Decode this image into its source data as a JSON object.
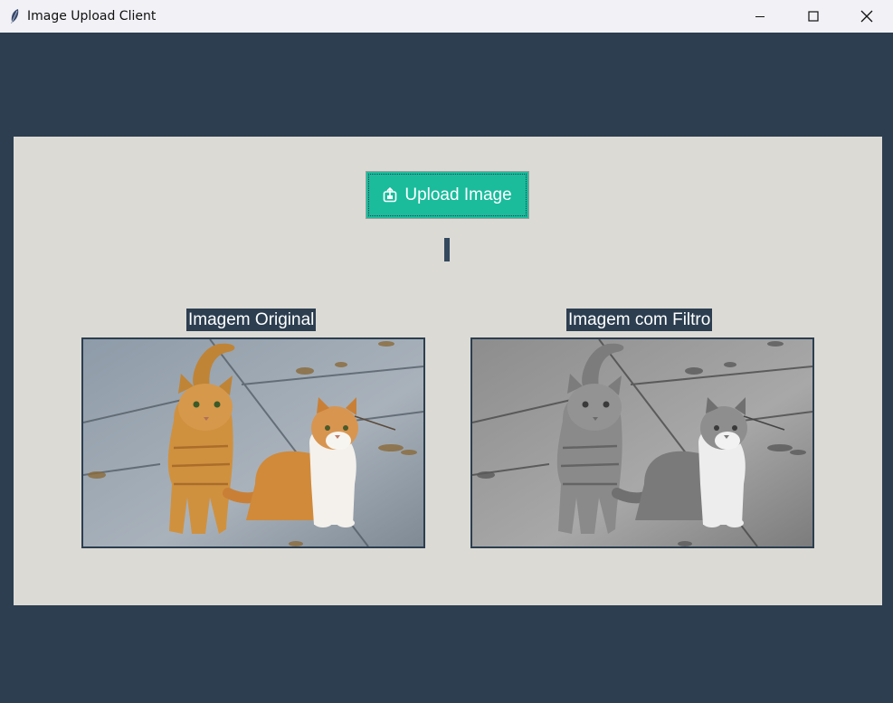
{
  "window": {
    "title": "Image Upload Client",
    "controls": [
      "minimize",
      "maximize",
      "close"
    ]
  },
  "toolbar": {
    "upload_label": "Upload Image",
    "upload_icon": "upload-icon"
  },
  "images": {
    "original": {
      "label": "Imagem Original"
    },
    "filtered": {
      "label": "Imagem com Filtro"
    }
  },
  "colors": {
    "background": "#2c3e50",
    "panel": "#dcdad5",
    "accent": "#1abc9c"
  }
}
